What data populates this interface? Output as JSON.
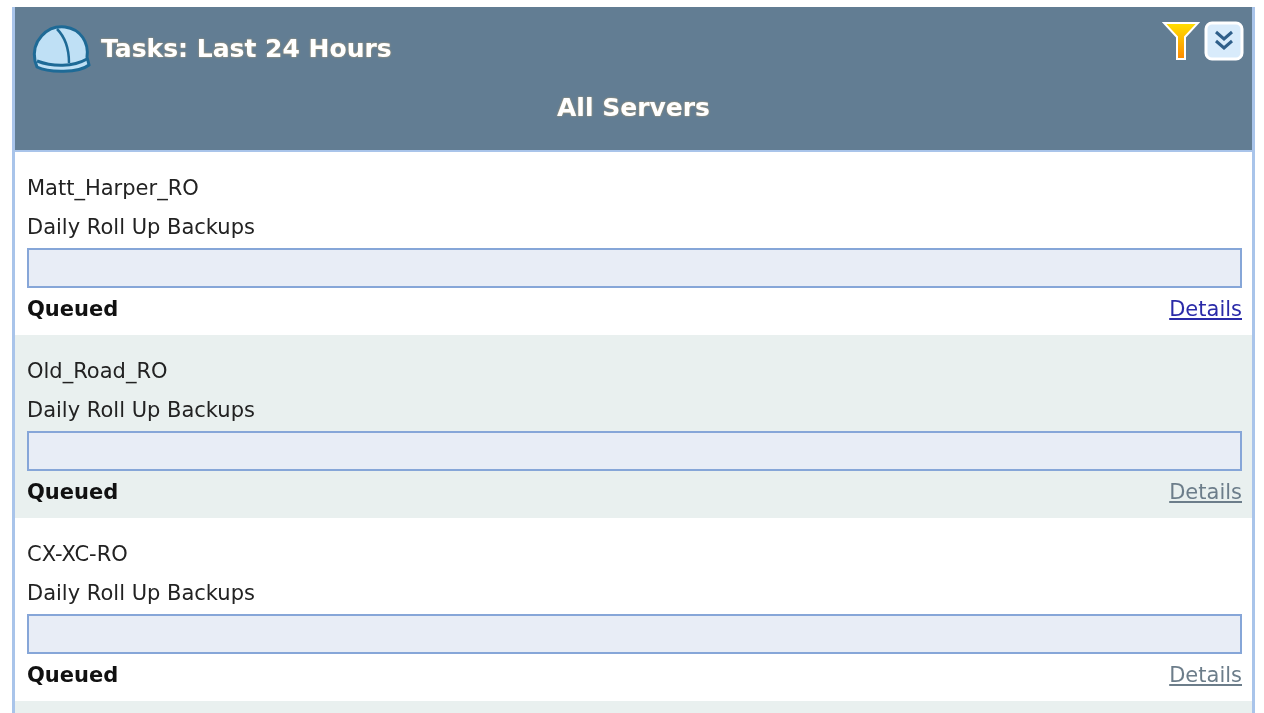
{
  "panel": {
    "title": "Tasks: Last 24 Hours",
    "subtitle": "All Servers"
  },
  "tasks": [
    {
      "server": "Matt_Harper_RO",
      "job": "Daily Roll Up Backups",
      "level": 0,
      "status": "Queued",
      "link": "Details",
      "visited": false
    },
    {
      "server": "Old_Road_RO",
      "job": "Daily Roll Up Backups",
      "level": 0,
      "status": "Queued",
      "link": "Details",
      "visited": true
    },
    {
      "server": "CX-XC-RO",
      "job": "Daily Roll Up Backups",
      "level": 0,
      "status": "Queued",
      "link": "Details",
      "visited": true
    }
  ]
}
